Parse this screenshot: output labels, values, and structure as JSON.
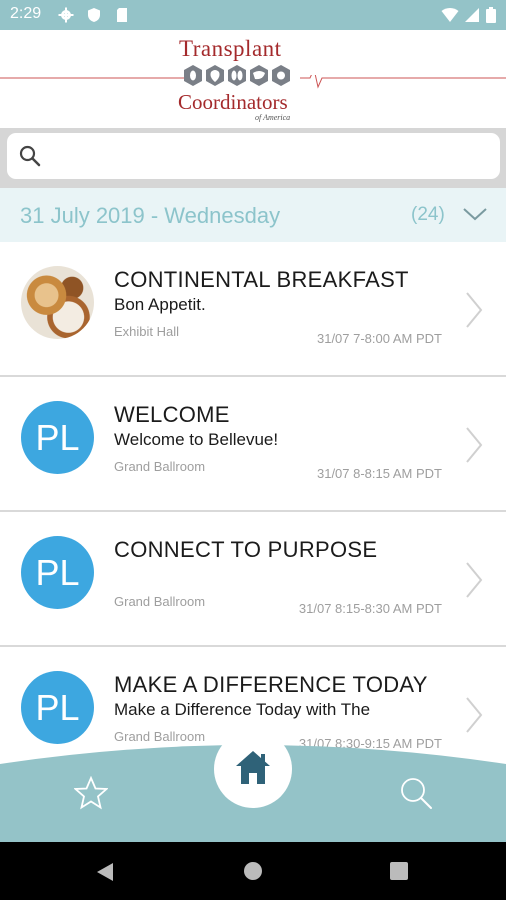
{
  "status_bar": {
    "time": "2:29"
  },
  "header": {
    "logo_line1": "Transplant",
    "logo_line2": "Coordinators",
    "logo_line3": "of America"
  },
  "search": {
    "placeholder": ""
  },
  "date_header": {
    "date": "31 July 2019 - Wednesday",
    "count": "(24)"
  },
  "sessions": [
    {
      "avatar": "",
      "title": "CONTINENTAL BREAKFAST",
      "subtitle": "Bon Appetit.",
      "location": "Exhibit Hall",
      "time": "31/07 7-8:00 AM PDT"
    },
    {
      "avatar": "PL",
      "title": "WELCOME",
      "subtitle": "Welcome to Bellevue!",
      "location": "Grand Ballroom",
      "time": "31/07 8-8:15 AM PDT"
    },
    {
      "avatar": "PL",
      "title": "CONNECT TO PURPOSE",
      "subtitle": "",
      "location": "Grand Ballroom",
      "time": "31/07 8:15-8:30 AM PDT"
    },
    {
      "avatar": "PL",
      "title": "MAKE A DIFFERENCE TODAY",
      "subtitle": "Make a Difference Today with The",
      "location": "Grand Ballroom",
      "time": "31/07 8:30-9:15 AM PDT"
    }
  ],
  "bottom_nav": {
    "items": [
      "star-icon",
      "home-icon",
      "search-icon"
    ],
    "accent": "#94c3c8"
  },
  "colors": {
    "status_bar": "#94c3c8",
    "brand": "#a42a2c",
    "avatar": "#3da7e0",
    "date_text": "#8cc4cb"
  }
}
